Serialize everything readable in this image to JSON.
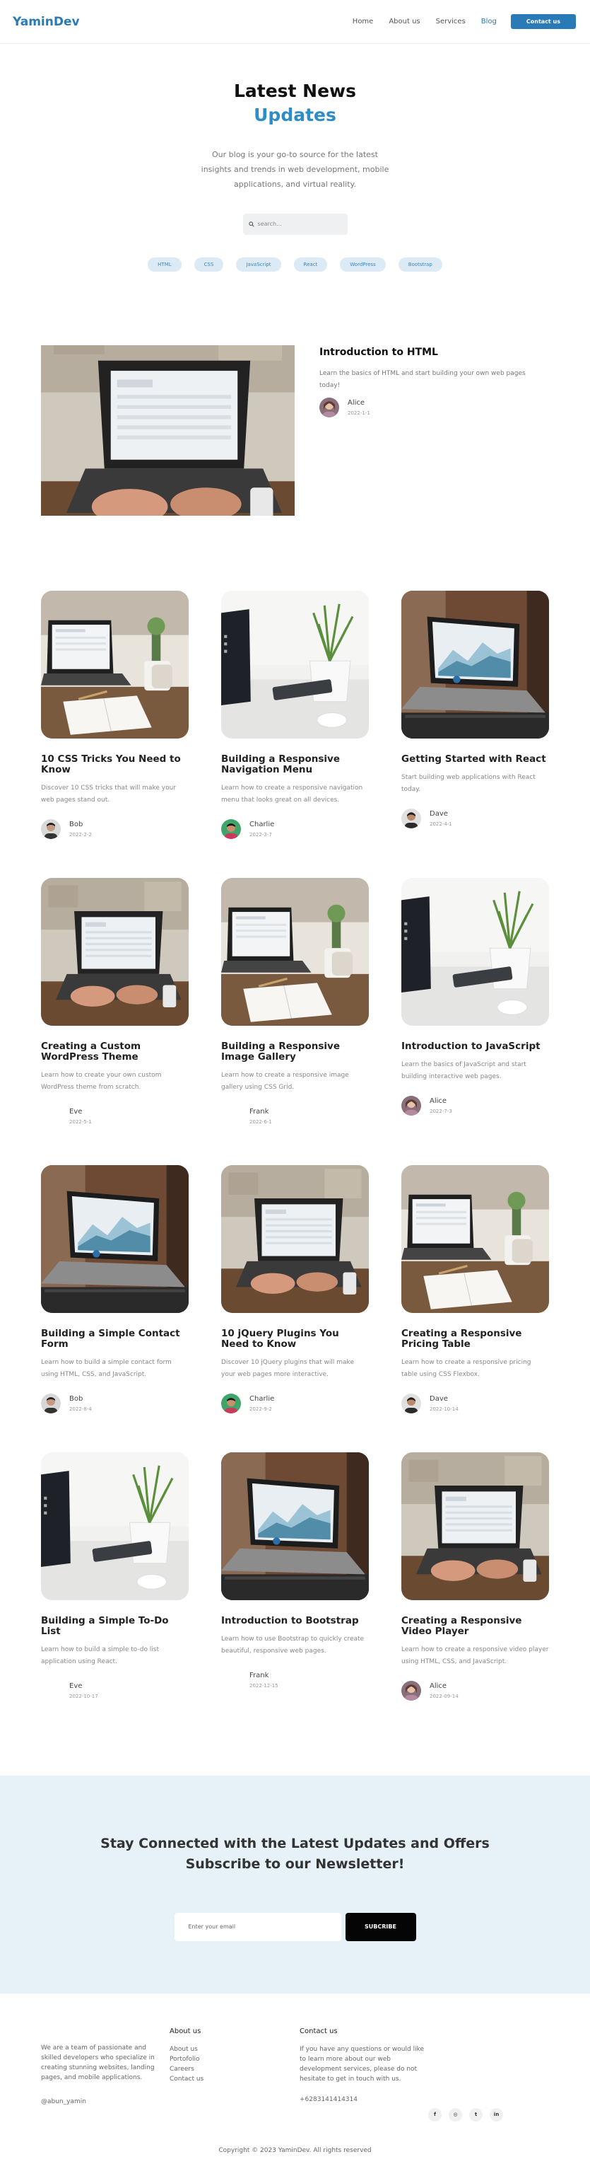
{
  "header": {
    "logo": "YaminDev",
    "nav": [
      {
        "label": "Home",
        "active": false
      },
      {
        "label": "About us",
        "active": false
      },
      {
        "label": "Services",
        "active": false
      },
      {
        "label": "Blog",
        "active": true
      }
    ],
    "contact_button": "Contact us",
    "accent_color": "#2a7ab8"
  },
  "hero": {
    "title": "Latest News",
    "subtitle": "Updates",
    "description": "Our blog is your go-to source for the latest insights and trends in web development, mobile applications, and virtual reality.",
    "search_placeholder": "search...",
    "search_icon": "search-icon",
    "tags": [
      "HTML",
      "CSS",
      "JavaScript",
      "React",
      "WordPress",
      "Bootstrap"
    ]
  },
  "featured": {
    "title": "Introduction to HTML",
    "description": "Learn the basics of HTML and start building your own web pages today!",
    "author": "Alice",
    "date": "2022-1-1",
    "image": "laptop-typing"
  },
  "posts": [
    {
      "title": "10 CSS Tricks You Need to Know",
      "description": "Discover 10 CSS tricks that will make your web pages stand out.",
      "author": "Bob",
      "date": "2022-2-2",
      "image": "laptop-desk",
      "avatar": "bob"
    },
    {
      "title": "Building a Responsive Navigation Menu",
      "description": "Learn how to create a responsive navigation menu that looks great on all devices.",
      "author": "Charlie",
      "date": "2022-3-7",
      "image": "plant-desk",
      "avatar": "charlie"
    },
    {
      "title": "Getting Started with React",
      "description": "Start building web applications with React today.",
      "author": "Dave",
      "date": "2022-4-1",
      "image": "laptop-chart",
      "avatar": "dave"
    },
    {
      "title": "Creating a Custom WordPress Theme",
      "description": "Learn how to create your own custom WordPress theme from scratch.",
      "author": "Eve",
      "date": "2022-5-1",
      "image": "laptop-typing",
      "avatar": "none"
    },
    {
      "title": "Building a Responsive Image Gallery",
      "description": "Learn how to create a responsive image gallery using CSS Grid.",
      "author": "Frank",
      "date": "2022-6-1",
      "image": "laptop-desk",
      "avatar": "none"
    },
    {
      "title": "Introduction to JavaScript",
      "description": "Learn the basics of JavaScript and start building interactive web pages.",
      "author": "Alice",
      "date": "2022-7-3",
      "image": "plant-desk",
      "avatar": "alice"
    },
    {
      "title": "Building a Simple Contact Form",
      "description": "Learn how to build a simple contact form using HTML, CSS, and JavaScript.",
      "author": "Bob",
      "date": "2022-8-4",
      "image": "laptop-chart",
      "avatar": "bob"
    },
    {
      "title": "10 jQuery Plugins You Need to Know",
      "description": "Discover 10 jQuery plugins that will make your web pages more interactive.",
      "author": "Charlie",
      "date": "2022-9-2",
      "image": "laptop-typing",
      "avatar": "charlie"
    },
    {
      "title": "Creating a Responsive Pricing Table",
      "description": "Learn how to create a responsive pricing table using CSS Flexbox.",
      "author": "Dave",
      "date": "2022-10-14",
      "image": "laptop-desk",
      "avatar": "dave"
    },
    {
      "title": "Building a Simple To-Do List",
      "description": "Learn how to build a simple to-do list application using React.",
      "author": "Eve",
      "date": "2022-10-17",
      "image": "plant-desk",
      "avatar": "none"
    },
    {
      "title": "Introduction to Bootstrap",
      "description": "Learn how to use Bootstrap to quickly create beautiful, responsive web pages.",
      "author": "Frank",
      "date": "2022-12-15",
      "image": "laptop-chart",
      "avatar": "none"
    },
    {
      "title": "Creating a Responsive Video Player",
      "description": "Learn how to create a responsive video player using HTML, CSS, and JavaScript.",
      "author": "Alice",
      "date": "2022-09-14",
      "image": "laptop-typing",
      "avatar": "alice"
    }
  ],
  "newsletter": {
    "title": "Stay Connected with the Latest Updates and Offers Subscribe to our Newsletter!",
    "email_placeholder": "Enter your email",
    "button": "SUBCRIBE",
    "background": "#e6f1f8"
  },
  "footer": {
    "about_text": "We are a team of passionate and skilled developers who specialize in creating stunning websites, landing pages, and mobile applications.",
    "handle": "@abun_yamin",
    "about_heading": "About us",
    "about_links": [
      "About us",
      "Portofolio",
      "Careers",
      "Contact us"
    ],
    "contact_heading": "Contact us",
    "contact_text": "If you have any questions or would like to learn more about our web development services, please do not hesitate to get in touch with us.",
    "phone": "+6283141414314",
    "socials": [
      {
        "label": "f",
        "icon": "facebook-icon"
      },
      {
        "label": "◎",
        "icon": "instagram-icon"
      },
      {
        "label": "t",
        "icon": "twitter-icon"
      },
      {
        "label": "in",
        "icon": "linkedin-icon"
      }
    ],
    "copyright": "Copyright © 2023 YaminDev. All rights reserved"
  }
}
